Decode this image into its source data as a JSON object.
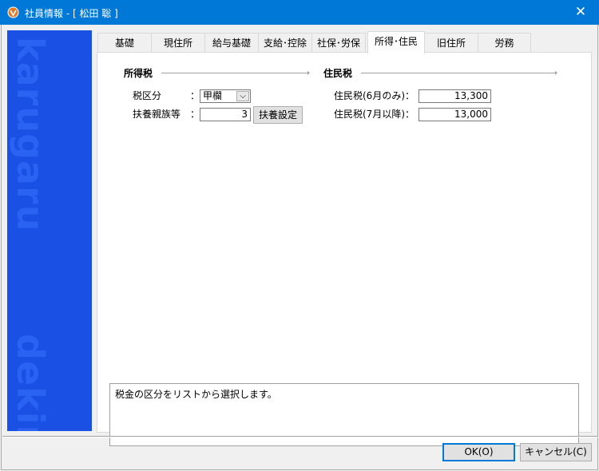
{
  "window": {
    "title": "社員情報 - [ 松田 聡 ]",
    "close_glyph": "✕"
  },
  "side_panel": {
    "watermark_top": "karugaru",
    "watermark_bottom": "dekiru"
  },
  "tabs": [
    {
      "label": "基礎",
      "active": false
    },
    {
      "label": "現住所",
      "active": false
    },
    {
      "label": "給与基礎",
      "active": false
    },
    {
      "label": "支給･控除",
      "active": false
    },
    {
      "label": "社保･労保",
      "active": false
    },
    {
      "label": "所得･住民",
      "active": true
    },
    {
      "label": "旧住所",
      "active": false
    },
    {
      "label": "労務",
      "active": false
    }
  ],
  "income_tax": {
    "title": "所得税",
    "tax_class_label": "税区分",
    "tax_class_colon": "：",
    "tax_class_value": "甲欄",
    "dependents_label": "扶養親族等",
    "dependents_colon": "：",
    "dependents_value": "3",
    "dependents_button": "扶養設定"
  },
  "resident_tax": {
    "title": "住民税",
    "june_label": "住民税(6月のみ)：",
    "june_value": "13,300",
    "july_label": "住民税(7月以降)：",
    "july_value": "13,000"
  },
  "help_text": "税金の区分をリストから選択します。",
  "footer": {
    "ok_label": "OK(O)",
    "cancel_label": "キャンセル(C)"
  },
  "colors": {
    "titlebar": "#0078d7",
    "side_panel": "#1a50e4"
  }
}
